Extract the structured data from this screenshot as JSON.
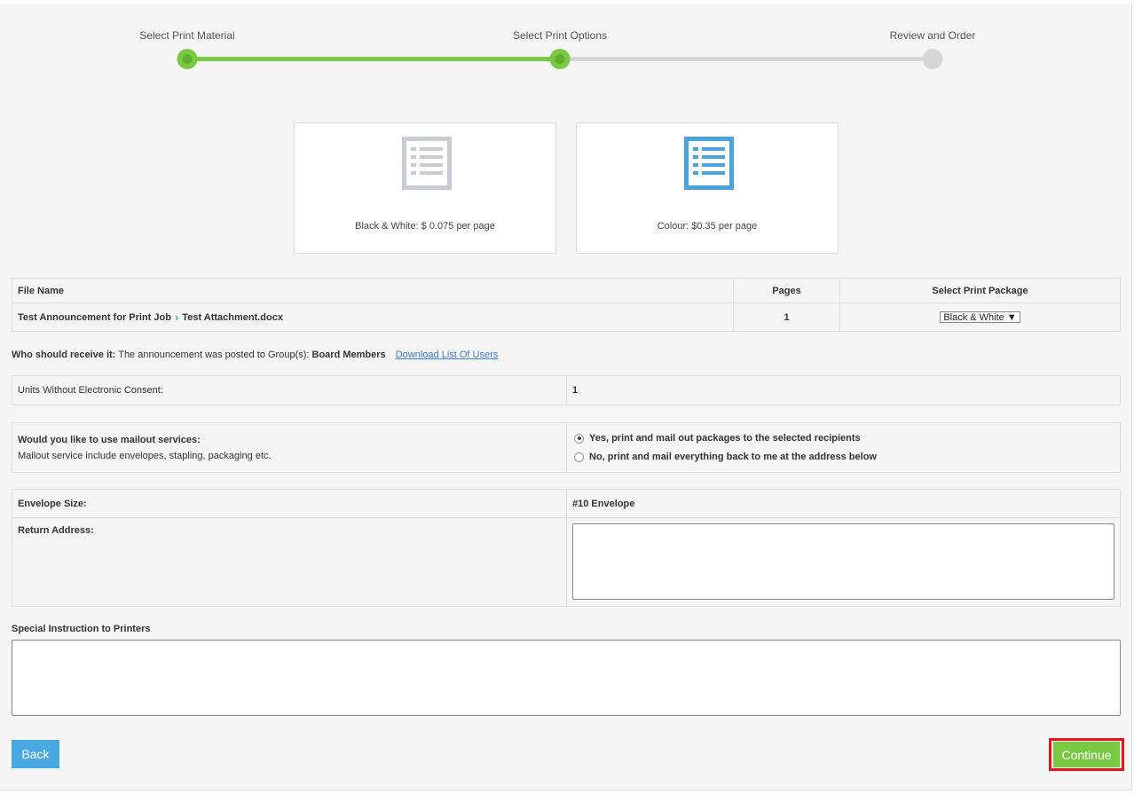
{
  "stepper": {
    "steps": [
      {
        "label": "Select Print Material",
        "state": "done"
      },
      {
        "label": "Select Print Options",
        "state": "current"
      },
      {
        "label": "Review and Order",
        "state": "todo"
      }
    ],
    "colors": {
      "done": "#7ac943",
      "todo": "#d6d6d6"
    }
  },
  "cards": [
    {
      "label": "Black & White: $ 0.075 per page",
      "icon": "document-list-icon",
      "color": "#c9ccd4"
    },
    {
      "label": "Colour: $0.35 per page",
      "icon": "document-list-icon",
      "color": "#4aa3df"
    }
  ],
  "file_table": {
    "headers": {
      "name": "File Name",
      "pages": "Pages",
      "package": "Select Print Package"
    },
    "row": {
      "announcement": "Test Announcement for Print Job",
      "attachment": "Test Attachment.docx",
      "pages": "1",
      "package": "Black & White"
    }
  },
  "recipients": {
    "label": "Who should receive it:",
    "text": "The announcement was posted to Group(s):",
    "group": "Board Members",
    "download_link": "Download List Of Users"
  },
  "consent": {
    "label": "Units Without Electronic Consent:",
    "value": "1"
  },
  "mailout": {
    "question": "Would you like to use mailout services:",
    "description": "Mailout service include envelopes, stapling, packaging etc.",
    "options": [
      {
        "label": "Yes, print and mail out packages to the selected recipients",
        "selected": true
      },
      {
        "label": "No, print and mail everything back to me at the address below",
        "selected": false
      }
    ]
  },
  "envelope": {
    "size_label": "Envelope Size:",
    "size_value": "#10 Envelope",
    "return_label": "Return Address:",
    "return_value": ""
  },
  "special": {
    "label": "Special Instruction to Printers",
    "value": ""
  },
  "buttons": {
    "back": "Back",
    "continue": "Continue"
  }
}
